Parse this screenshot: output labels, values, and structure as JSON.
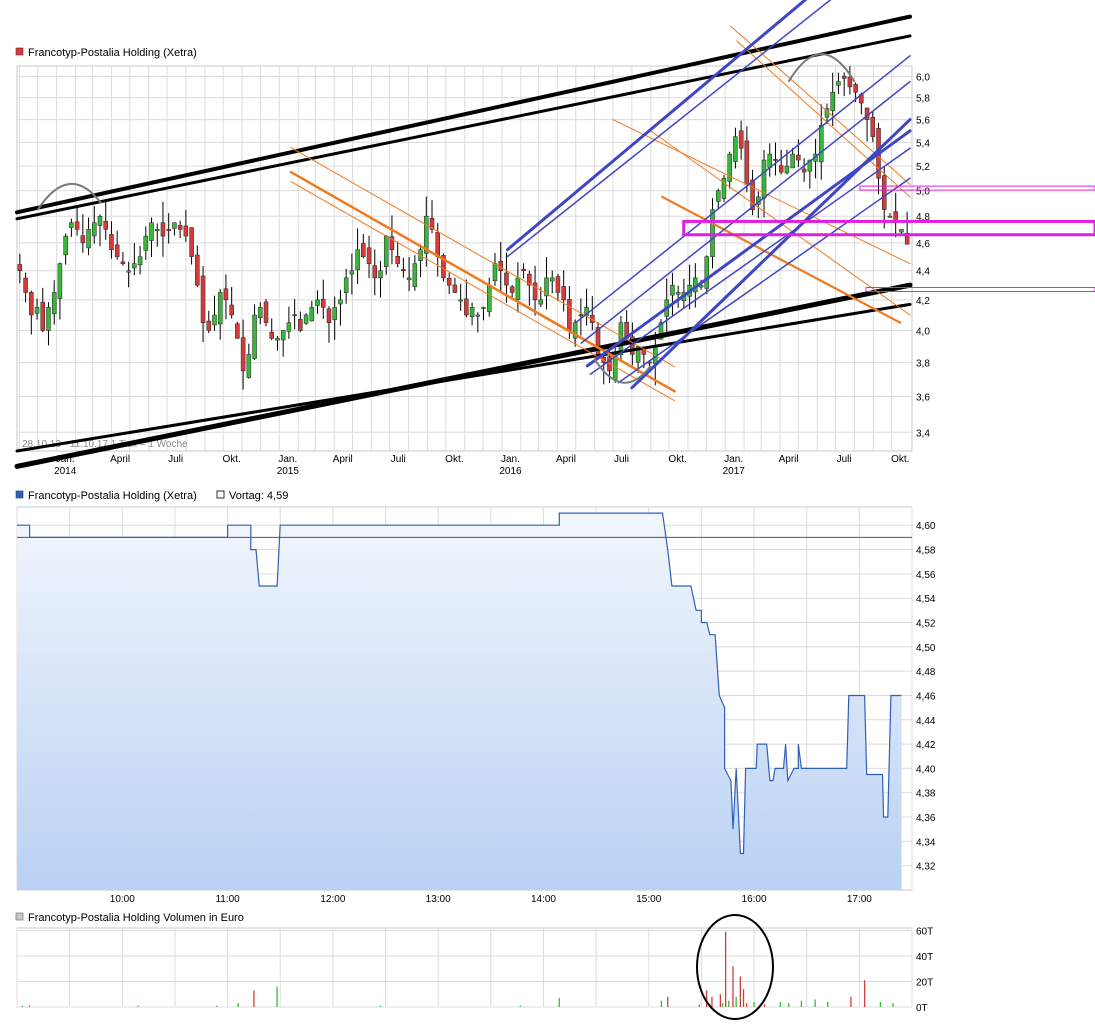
{
  "colors": {
    "candle_up": "#38b838",
    "candle_down": "#d43c3c",
    "grid": "#dcdcdc",
    "intraday_line": "#3060b8",
    "area_top": "#f2f6fc",
    "area_bottom": "#b9d1f3",
    "trend_blue": "#3f45c4",
    "trend_orange": "#f07a22",
    "trend_magenta": "#e020e0",
    "trend_black": "#000000",
    "annotation_grey": "#7a7a7a",
    "volume_up": "#38b838",
    "volume_down": "#d43c3c"
  },
  "chart_data": [
    {
      "type": "candlestick",
      "title": "Francotyp-Postalia Holding (Xetra)",
      "legend_marker": "square-red",
      "note": "28.10.13 - 11.10.17   1 Tick = 1 Woche",
      "x_tick_labels": [
        {
          "label": "Jan.",
          "year": "2014"
        },
        {
          "label": "April",
          "year": ""
        },
        {
          "label": "Juli",
          "year": ""
        },
        {
          "label": "Okt.",
          "year": ""
        },
        {
          "label": "Jan.",
          "year": "2015"
        },
        {
          "label": "April",
          "year": ""
        },
        {
          "label": "Juli",
          "year": ""
        },
        {
          "label": "Okt.",
          "year": ""
        },
        {
          "label": "Jan.",
          "year": "2016"
        },
        {
          "label": "April",
          "year": ""
        },
        {
          "label": "Juli",
          "year": ""
        },
        {
          "label": "Okt.",
          "year": ""
        },
        {
          "label": "Jan.",
          "year": "2017"
        },
        {
          "label": "April",
          "year": ""
        },
        {
          "label": "Juli",
          "year": ""
        },
        {
          "label": "Okt.",
          "year": ""
        }
      ],
      "y_ticks": [
        "3,4",
        "3,6",
        "3,8",
        "4,0",
        "4,2",
        "4,4",
        "4,6",
        "4,8",
        "5,0",
        "5,2",
        "5,4",
        "5,6",
        "5,8",
        "6,0"
      ],
      "y_tick_values": [
        3.4,
        3.6,
        3.8,
        4.0,
        4.2,
        4.4,
        4.6,
        4.8,
        5.0,
        5.2,
        5.4,
        5.6,
        5.8,
        6.0
      ],
      "y_scale": "log",
      "ylim": [
        3.3,
        6.1
      ],
      "closes_weekly": [
        4.4,
        4.25,
        4.1,
        4.15,
        4.0,
        4.15,
        4.25,
        4.45,
        4.65,
        4.75,
        4.7,
        4.6,
        4.7,
        4.75,
        4.8,
        4.7,
        4.55,
        4.5,
        4.45,
        4.4,
        4.45,
        4.5,
        4.65,
        4.75,
        4.7,
        4.65,
        4.7,
        4.75,
        4.7,
        4.65,
        4.5,
        4.3,
        4.05,
        4.0,
        4.1,
        4.25,
        4.2,
        4.1,
        3.95,
        3.75,
        3.85,
        4.1,
        4.15,
        4.05,
        3.95,
        3.95,
        4.0,
        4.05,
        4.1,
        4.0,
        4.1,
        4.15,
        4.2,
        4.15,
        4.05,
        4.15,
        4.2,
        4.35,
        4.4,
        4.55,
        4.5,
        4.45,
        4.35,
        4.4,
        4.65,
        4.55,
        4.45,
        4.4,
        4.35,
        4.45,
        4.55,
        4.8,
        4.7,
        4.5,
        4.35,
        4.3,
        4.25,
        4.2,
        4.1,
        4.15,
        4.1,
        4.15,
        4.3,
        4.45,
        4.4,
        4.3,
        4.25,
        4.35,
        4.4,
        4.3,
        4.2,
        4.2,
        4.35,
        4.35,
        4.25,
        4.2,
        4.0,
        4.05,
        4.1,
        4.15,
        4.05,
        3.85,
        3.8,
        3.75,
        3.85,
        4.05,
        3.95,
        3.85,
        3.9,
        3.85,
        3.8,
        3.9,
        4.05,
        4.2,
        4.3,
        4.25,
        4.25,
        4.3,
        4.35,
        4.3,
        4.5,
        4.85,
        5.0,
        5.1,
        5.3,
        5.45,
        5.35,
        5.05,
        4.85,
        4.95,
        5.25,
        5.3,
        5.25,
        5.15,
        5.2,
        5.3,
        5.25,
        5.15,
        5.25,
        5.3,
        5.55,
        5.7,
        5.85,
        5.95,
        5.98,
        5.9,
        5.85,
        5.75,
        5.6,
        5.45,
        5.1,
        4.85,
        4.8,
        4.75,
        4.7,
        4.59
      ],
      "annotations": {
        "black_lines": [
          {
            "from": [
              "2013-10-28",
              4.83
            ],
            "to": [
              "2017-10-31",
              6.6
            ],
            "width": 4
          },
          {
            "from": [
              "2013-10-28",
              4.78
            ],
            "to": [
              "2017-10-31",
              6.4
            ],
            "width": 3
          },
          {
            "from": [
              "2013-10-28",
              3.22
            ],
            "to": [
              "2017-10-31",
              4.3
            ],
            "width": 5
          },
          {
            "from": [
              "2013-10-28",
              3.3
            ],
            "to": [
              "2017-10-31",
              4.17
            ],
            "width": 3
          }
        ],
        "orange_channel": {
          "from": [
            "2015-01-20",
            5.15
          ],
          "to": [
            "2016-10-10",
            3.63
          ]
        },
        "blue_channel": {
          "from": [
            "2016-04-15",
            3.75
          ],
          "to": [
            "2017-10-31",
            5.9
          ]
        },
        "magenta_zone": [
          4.66,
          4.76
        ],
        "magenta_level_upper": 5.02,
        "magenta_level_lower": 4.27
      }
    },
    {
      "type": "line",
      "title": "Francotyp-Postalia Holding (Xetra)",
      "legend_marker": "square-blue",
      "prev_close_label": "Vortag: 4,59",
      "prev_close": 4.59,
      "x_tick_labels": [
        "10:00",
        "11:00",
        "12:00",
        "13:00",
        "14:00",
        "15:00",
        "16:00",
        "17:00"
      ],
      "y_ticks": [
        "4,32",
        "4,34",
        "4,36",
        "4,38",
        "4,40",
        "4,42",
        "4,44",
        "4,46",
        "4,48",
        "4,50",
        "4,52",
        "4,54",
        "4,56",
        "4,58",
        "4,60"
      ],
      "y_tick_values": [
        4.32,
        4.34,
        4.36,
        4.38,
        4.4,
        4.42,
        4.44,
        4.46,
        4.48,
        4.5,
        4.52,
        4.54,
        4.56,
        4.58,
        4.6
      ],
      "ylim": [
        4.3,
        4.615
      ],
      "xlim_hours": [
        9.0,
        17.5
      ],
      "points": [
        [
          9.0,
          4.6
        ],
        [
          9.12,
          4.6
        ],
        [
          9.12,
          4.59
        ],
        [
          11.0,
          4.59
        ],
        [
          11.0,
          4.6
        ],
        [
          11.22,
          4.6
        ],
        [
          11.22,
          4.58
        ],
        [
          11.27,
          4.58
        ],
        [
          11.3,
          4.55
        ],
        [
          11.47,
          4.55
        ],
        [
          11.5,
          4.6
        ],
        [
          14.15,
          4.6
        ],
        [
          14.15,
          4.61
        ],
        [
          15.13,
          4.61
        ],
        [
          15.18,
          4.58
        ],
        [
          15.22,
          4.55
        ],
        [
          15.4,
          4.55
        ],
        [
          15.45,
          4.53
        ],
        [
          15.5,
          4.53
        ],
        [
          15.5,
          4.52
        ],
        [
          15.55,
          4.52
        ],
        [
          15.58,
          4.51
        ],
        [
          15.63,
          4.51
        ],
        [
          15.67,
          4.46
        ],
        [
          15.72,
          4.45
        ],
        [
          15.72,
          4.4
        ],
        [
          15.78,
          4.39
        ],
        [
          15.8,
          4.35
        ],
        [
          15.83,
          4.4
        ],
        [
          15.87,
          4.33
        ],
        [
          15.9,
          4.33
        ],
        [
          15.92,
          4.4
        ],
        [
          15.97,
          4.4
        ],
        [
          16.02,
          4.4
        ],
        [
          16.03,
          4.42
        ],
        [
          16.12,
          4.42
        ],
        [
          16.15,
          4.39
        ],
        [
          16.18,
          4.39
        ],
        [
          16.2,
          4.4
        ],
        [
          16.28,
          4.4
        ],
        [
          16.3,
          4.42
        ],
        [
          16.32,
          4.39
        ],
        [
          16.38,
          4.4
        ],
        [
          16.42,
          4.4
        ],
        [
          16.42,
          4.42
        ],
        [
          16.45,
          4.4
        ],
        [
          16.88,
          4.4
        ],
        [
          16.9,
          4.46
        ],
        [
          17.05,
          4.46
        ],
        [
          17.07,
          4.395
        ],
        [
          17.22,
          4.395
        ],
        [
          17.23,
          4.36
        ],
        [
          17.27,
          4.36
        ],
        [
          17.3,
          4.46
        ],
        [
          17.4,
          4.46
        ]
      ]
    },
    {
      "type": "bar",
      "title": "Francotyp-Postalia Holding Volumen in Euro",
      "legend_marker": "square-grey",
      "y_ticks": [
        "0T",
        "20T",
        "40T",
        "60T"
      ],
      "y_tick_values": [
        0,
        20,
        40,
        60
      ],
      "ylim": [
        0,
        62
      ],
      "unit": "T",
      "bars": [
        [
          9.05,
          1,
          "g"
        ],
        [
          9.12,
          1,
          "r"
        ],
        [
          10.15,
          1,
          "g"
        ],
        [
          10.9,
          1,
          "g"
        ],
        [
          11.1,
          3,
          "g"
        ],
        [
          11.25,
          13,
          "r"
        ],
        [
          11.47,
          16,
          "g"
        ],
        [
          12.45,
          1,
          "g"
        ],
        [
          13.78,
          1,
          "g"
        ],
        [
          14.15,
          7,
          "g"
        ],
        [
          15.12,
          5,
          "g"
        ],
        [
          15.18,
          8,
          "r"
        ],
        [
          15.48,
          2,
          "g"
        ],
        [
          15.55,
          13,
          "r"
        ],
        [
          15.6,
          8,
          "r"
        ],
        [
          15.68,
          10,
          "r"
        ],
        [
          15.7,
          3,
          "g"
        ],
        [
          15.73,
          59,
          "r"
        ],
        [
          15.76,
          5,
          "g"
        ],
        [
          15.8,
          32,
          "r"
        ],
        [
          15.83,
          8,
          "g"
        ],
        [
          15.87,
          24,
          "r"
        ],
        [
          15.9,
          14,
          "r"
        ],
        [
          15.93,
          3,
          "r"
        ],
        [
          16.0,
          4,
          "g"
        ],
        [
          16.1,
          2,
          "r"
        ],
        [
          16.25,
          4,
          "g"
        ],
        [
          16.33,
          3,
          "g"
        ],
        [
          16.45,
          5,
          "g"
        ],
        [
          16.58,
          6,
          "g"
        ],
        [
          16.7,
          4,
          "g"
        ],
        [
          16.92,
          8,
          "r"
        ],
        [
          17.05,
          21,
          "r"
        ],
        [
          17.2,
          4,
          "g"
        ],
        [
          17.32,
          3,
          "g"
        ]
      ]
    }
  ]
}
